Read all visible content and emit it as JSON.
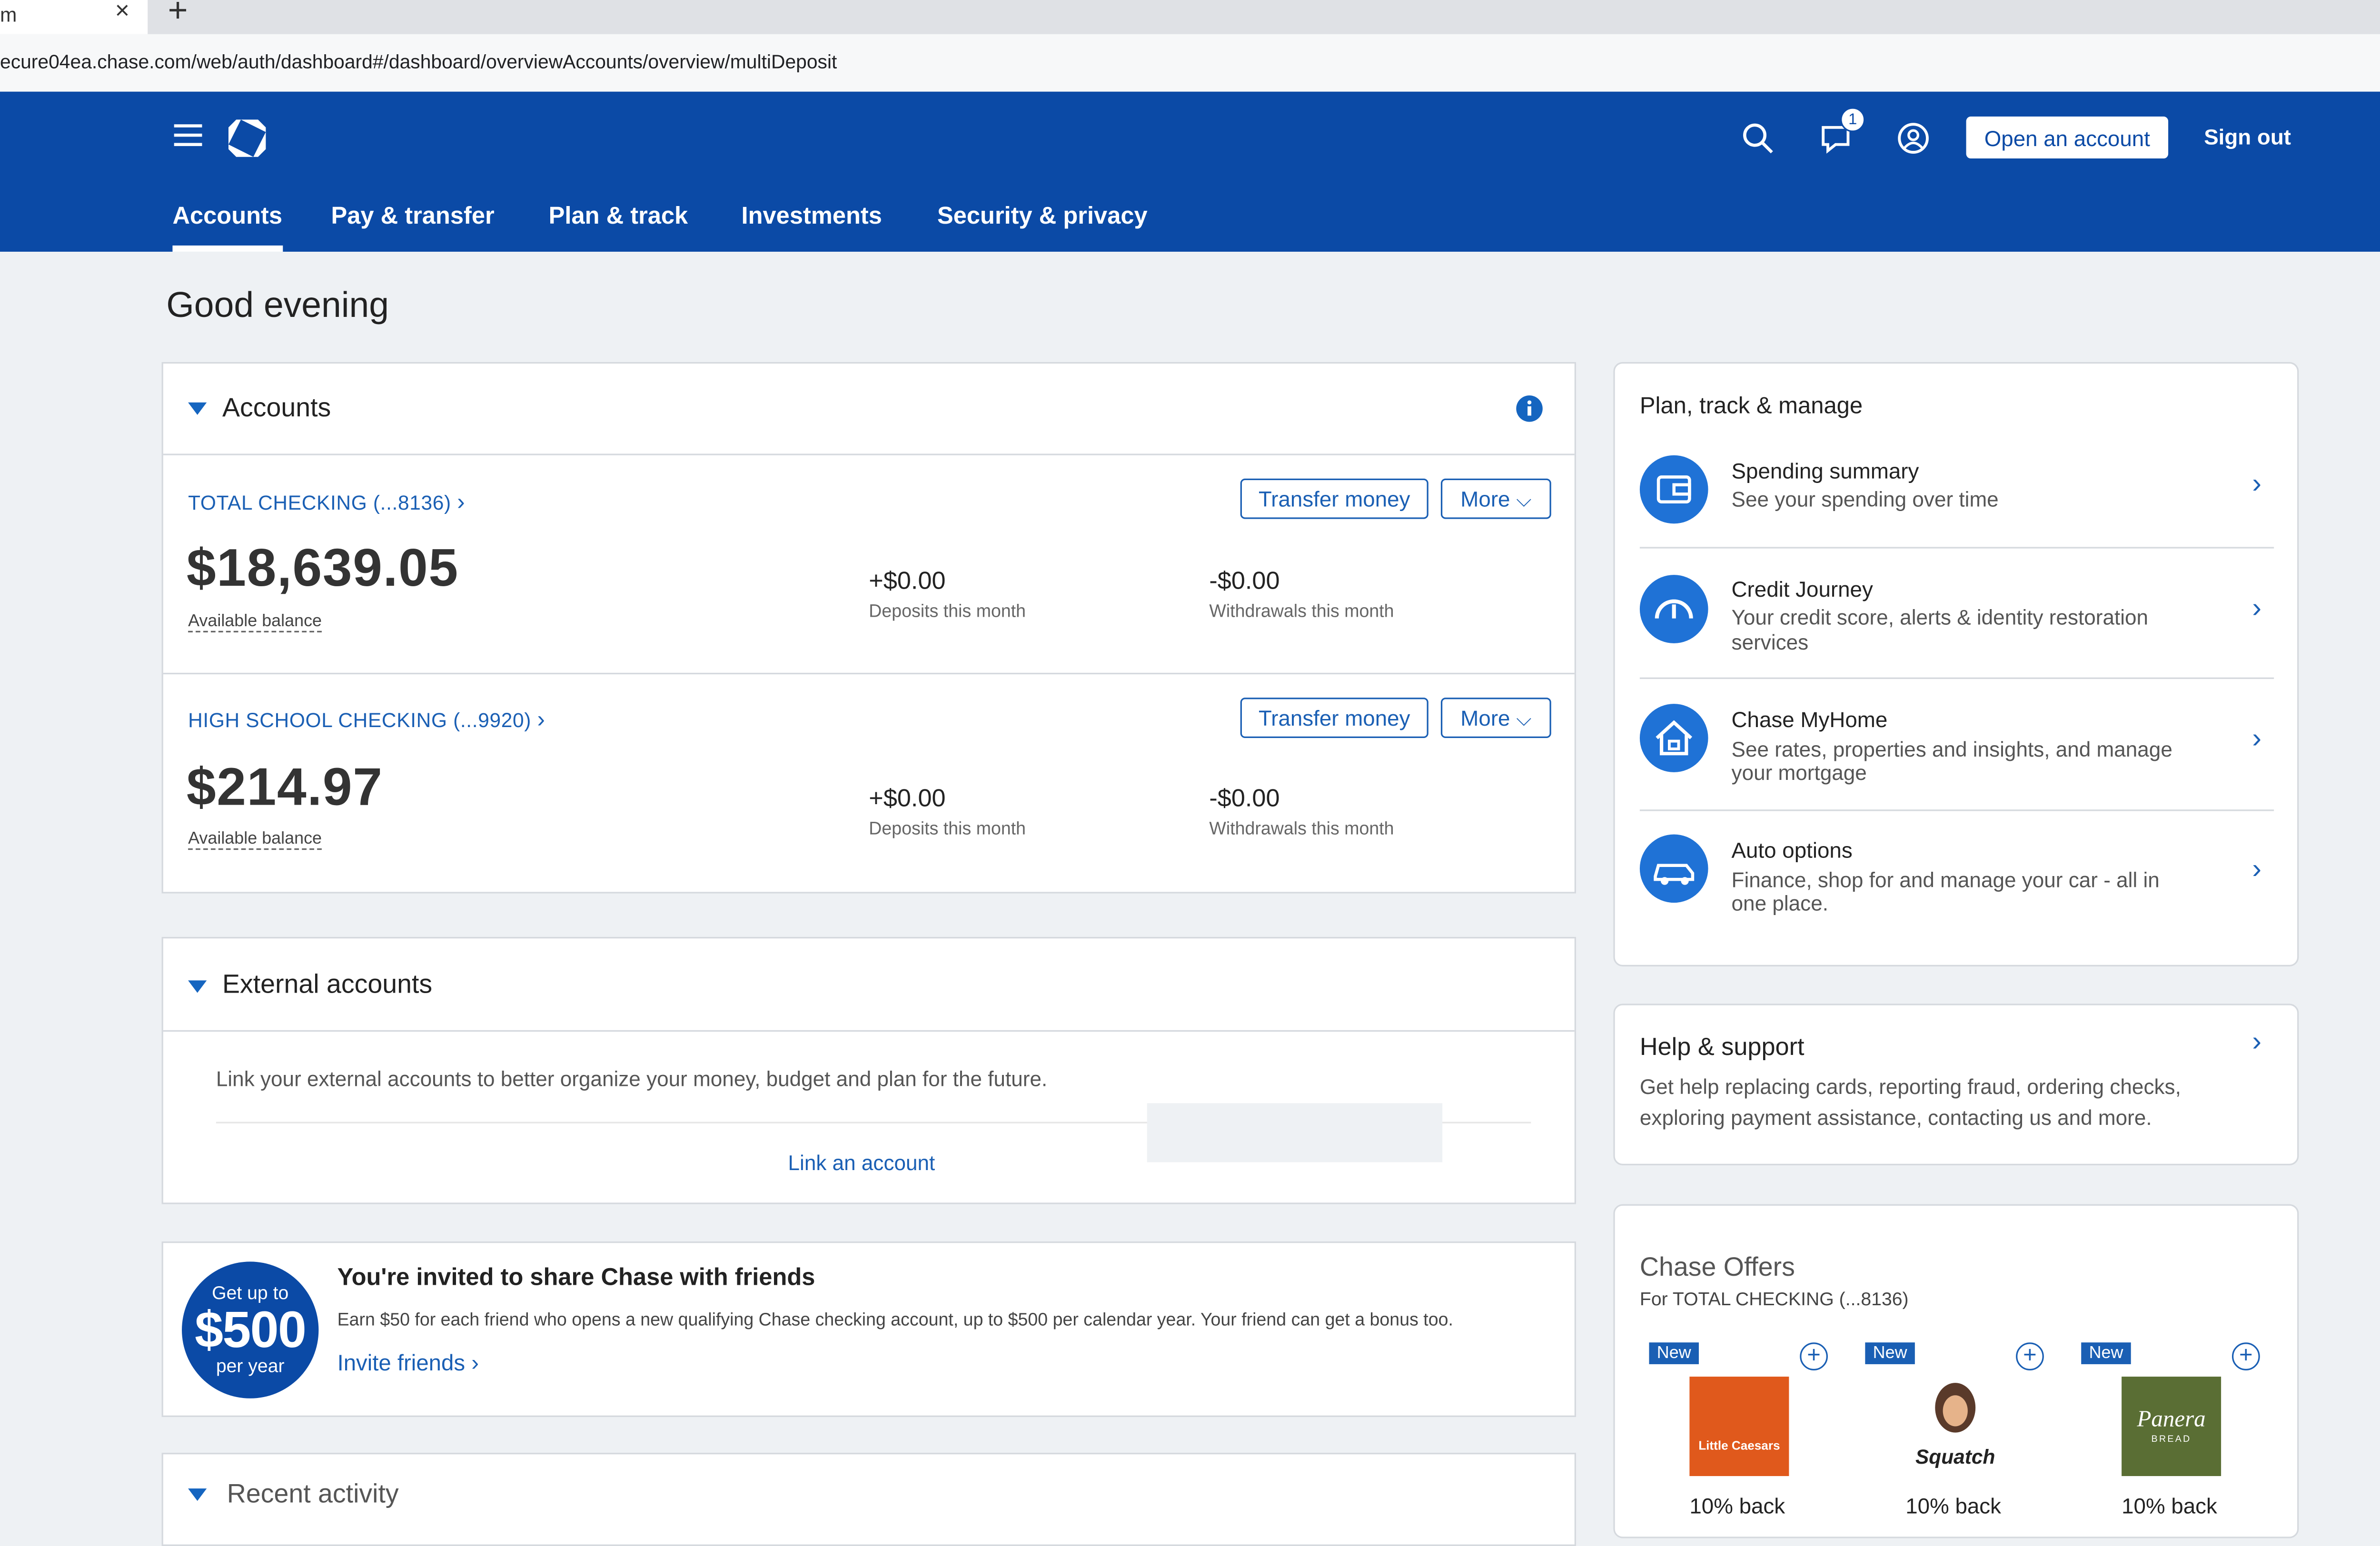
{
  "browser": {
    "tab_title": "m",
    "tab_close": "×",
    "new_tab": "+",
    "url": "ecure04ea.chase.com/web/auth/dashboard#/dashboard/overviewAccounts/overview/multiDeposit"
  },
  "header": {
    "notification_count": "1",
    "open_account_label": "Open an account",
    "sign_out_label": "Sign out",
    "nav": [
      "Accounts",
      "Pay & transfer",
      "Plan & track",
      "Investments",
      "Security & privacy"
    ],
    "active_nav": "Accounts",
    "brand_color": "#0b4aa6"
  },
  "greeting": "Good evening",
  "accounts_section": {
    "title": "Accounts",
    "accounts": [
      {
        "name": "TOTAL CHECKING (...8136)",
        "balance": "$18,639.05",
        "balance_label": "Available balance",
        "deposits": "+$0.00",
        "deposits_label": "Deposits this month",
        "withdrawals": "-$0.00",
        "withdrawals_label": "Withdrawals this month",
        "transfer_label": "Transfer money",
        "more_label": "More"
      },
      {
        "name": "HIGH SCHOOL CHECKING (...9920)",
        "balance": "$214.97",
        "balance_label": "Available balance",
        "deposits": "+$0.00",
        "deposits_label": "Deposits this month",
        "withdrawals": "-$0.00",
        "withdrawals_label": "Withdrawals this month",
        "transfer_label": "Transfer money",
        "more_label": "More"
      }
    ]
  },
  "external_accounts": {
    "title": "External accounts",
    "description": "Link your external accounts to better organize your money, budget and plan for the future.",
    "link_label": "Link an account"
  },
  "referral": {
    "badge_top": "Get up to",
    "badge_amount": "$500",
    "badge_bottom": "per year",
    "title": "You're invited to share Chase with friends",
    "description": "Earn $50 for each friend who opens a new qualifying Chase checking account, up to $500 per calendar year. Your friend can get a bonus too.",
    "link_label": "Invite friends"
  },
  "recent_activity": {
    "title": "Recent activity"
  },
  "plan_panel": {
    "title": "Plan, track & manage",
    "items": [
      {
        "title": "Spending summary",
        "desc1": "See your spending over time",
        "desc2": "",
        "icon": "wallet-icon"
      },
      {
        "title": "Credit Journey",
        "desc1": "Your credit score, alerts & identity restoration",
        "desc2": "services",
        "icon": "gauge-icon"
      },
      {
        "title": "Chase MyHome",
        "desc1": "See rates, properties and insights, and manage",
        "desc2": "your mortgage",
        "icon": "house-icon"
      },
      {
        "title": "Auto options",
        "desc1": "Finance, shop for and manage your car - all in",
        "desc2": "one place.",
        "icon": "car-icon"
      }
    ]
  },
  "help": {
    "title": "Help & support",
    "desc1": "Get help replacing cards, reporting fraud, ordering checks,",
    "desc2": "exploring payment assistance, contacting us and more."
  },
  "offers": {
    "title": "Chase Offers",
    "subtitle": "For TOTAL CHECKING (...8136)",
    "items": [
      {
        "badge": "New",
        "logo_text": "Little Caesars",
        "back": "10% back",
        "logo_color": "#e0591c"
      },
      {
        "badge": "New",
        "logo_text": "Squatch",
        "back": "10% back",
        "logo_color": "#ffffff"
      },
      {
        "badge": "New",
        "logo_text": "Panera",
        "logo_sub": "BREAD",
        "back": "10% back",
        "logo_color": "#5a6e34"
      }
    ]
  }
}
